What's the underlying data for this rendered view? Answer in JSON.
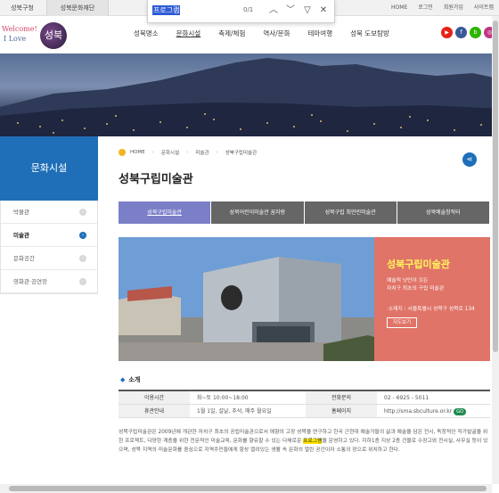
{
  "util": {
    "tab1": "성북구청",
    "tab2": "성북문화재단",
    "links": [
      "HOME",
      "로그인",
      "회원가입",
      "사이트맵"
    ]
  },
  "find": {
    "query": "프로그램",
    "count": "0/1"
  },
  "logo": {
    "line1": "Welcome!",
    "line2": "I Love",
    "mark": "성북"
  },
  "nav": [
    "성북명소",
    "문화시설",
    "축제/체험",
    "역사/문화",
    "테마여행",
    "성북 도보탐방"
  ],
  "sidebar": {
    "title": "문화시설",
    "items": [
      "박물관",
      "미술관",
      "문화공간",
      "영화관·공연장"
    ]
  },
  "breadcrumb": [
    "HOME",
    "문화시설",
    "미술관",
    "성북구립미술관"
  ],
  "page_title": "성북구립미술관",
  "tabs": [
    "성북구립미술관",
    "성북어린이미술관 꿈자랑",
    "성북구립 최만린미술관",
    "성북예술창작터"
  ],
  "card": {
    "title": "성북구립미술관",
    "p1": "예술적 낭만이 깃든",
    "p2": "자치구 최초의 구립 미술관",
    "address": "·소재지 : 서울특별시 성북구 성북로 134",
    "map_button": "지도보기"
  },
  "section_title": "소개",
  "info": {
    "hours_label": "이용시간",
    "hours": "화~토 10:00~18:00",
    "phone_label": "전화문의",
    "phone": "02 - 6925 - 5011",
    "closed_label": "휴관안내",
    "closed": "1월 1일, 설날, 추석, 매주 월요일",
    "web_label": "홈페이지",
    "web": "http://sma.sbculture.or.kr",
    "go": "GO"
  },
  "desc": {
    "a": "성북구립미술관은 2009년에 개관한 자치구 최초의 공립미술관으로서 예향의 고장 성북을 연구하고 한국 근현대 예술가들의 삶과 예술을 담은 전시, 독창적인 작가발굴을 위한 프로젝트, 다양한 계층을 위한 전문적인 미술교육, 문화를 향유할 수 있는 다채로운 ",
    "hl": "프로그램",
    "b": "을 운영하고 있다. 지하1층 지상 2층 건물로 수장고와 전시실, 사무실 등이 있으며, 성북 지역의 미술문화를 중심으로 지역주민들에게 항상 열려있는 생활 속 문화의 열린 공간이자 소통의 장으로 위치하고 한다."
  },
  "colors": {
    "primary": "#1f6fb8",
    "tab_active": "#7b7fc8",
    "card_bg": "#e07468",
    "card_title": "#fff45a"
  }
}
